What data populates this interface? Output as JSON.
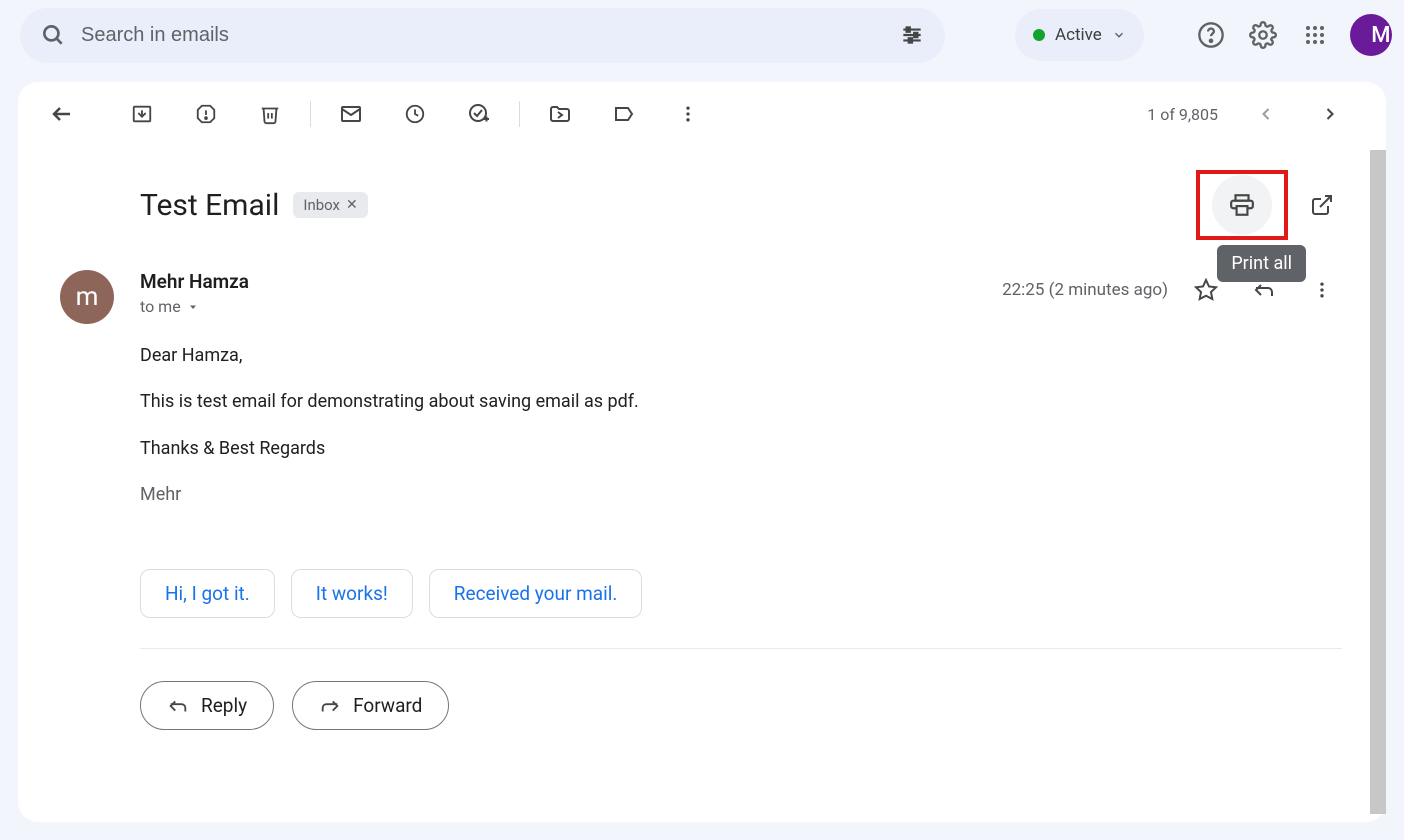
{
  "search": {
    "placeholder": "Search in emails"
  },
  "status": {
    "label": "Active"
  },
  "toolbar": {
    "page_info": "1 of 9,805"
  },
  "email": {
    "subject": "Test Email",
    "label": "Inbox",
    "sender_name": "Mehr Hamza",
    "sender_initial": "m",
    "to_line": "to me",
    "timestamp": "22:25 (2 minutes ago)",
    "body": {
      "greeting": "Dear Hamza,",
      "line1": "This is test email for demonstrating about saving email as pdf.",
      "closing": "Thanks & Best Regards",
      "signature": "Mehr"
    }
  },
  "smart_replies": [
    "Hi, I got it.",
    "It works!",
    "Received your mail."
  ],
  "actions": {
    "reply": "Reply",
    "forward": "Forward"
  },
  "tooltip": {
    "print": "Print all"
  },
  "profile_initial": "M"
}
